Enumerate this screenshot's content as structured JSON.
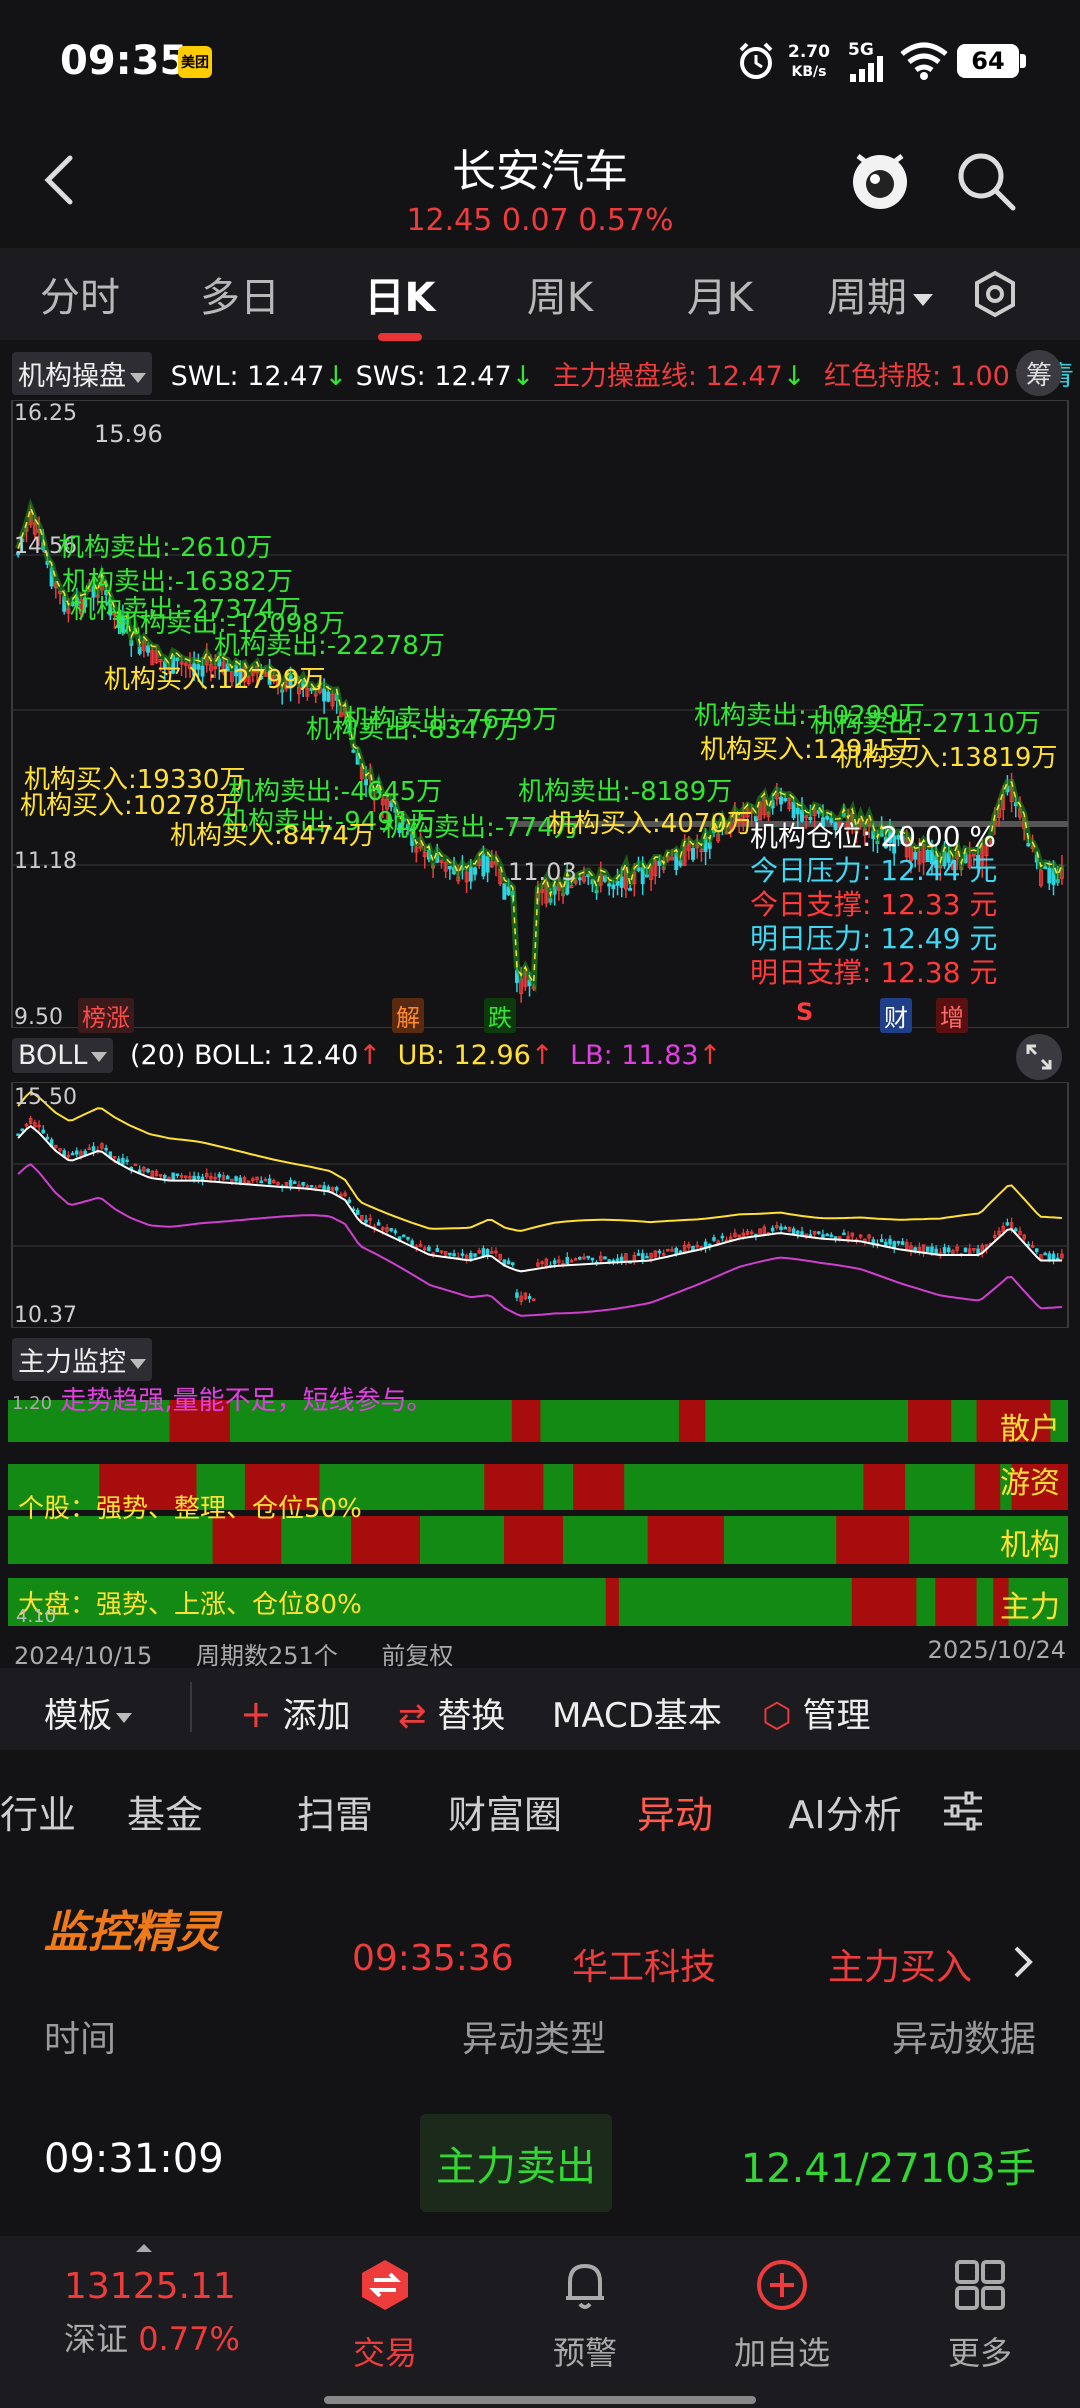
{
  "status": {
    "time": "09:35",
    "app_badge": "美团",
    "net_speed_value": "2.70",
    "net_speed_unit": "KB/s",
    "network": "5G",
    "battery": "64"
  },
  "header": {
    "stock_name": "长安汽车",
    "quote": "12.45 0.07 0.57%"
  },
  "period_tabs": [
    "分时",
    "多日",
    "日K",
    "周K",
    "月K",
    "周期"
  ],
  "main_indicator": {
    "selector": "机构操盘",
    "swl": "SWL: 12.47",
    "sws": "SWS: 12.47",
    "main_line": "主力操盘线: 12.47",
    "red_hold": "红色持股: 1.00",
    "cyan": "青",
    "chip_label": "筹",
    "y_labels": [
      "16.25",
      "14.56",
      "11.18",
      "9.50"
    ],
    "high_label": "15.96",
    "low_label": "11.03",
    "stats": [
      {
        "label": "机构仓位:",
        "value": "20.00 %",
        "color": "#ffffff"
      },
      {
        "label": "今日压力:",
        "value": "12.44 元",
        "color": "#3fd7f2"
      },
      {
        "label": "今日支撑:",
        "value": "12.33 元",
        "color": "#ff3a3a"
      },
      {
        "label": "明日压力:",
        "value": "12.49 元",
        "color": "#3fd7f2"
      },
      {
        "label": "明日支撑:",
        "value": "12.38 元",
        "color": "#ff3a3a"
      }
    ],
    "event_tags": [
      "榜涨",
      "解",
      "跌",
      "S",
      "财",
      "增"
    ],
    "annotations": [
      {
        "text": "机构卖出:-2610万",
        "color": "#33e633"
      },
      {
        "text": "机构卖出:-16382万",
        "color": "#33e633"
      },
      {
        "text": "机构卖出:-27374万",
        "color": "#33e633"
      },
      {
        "text": "机构卖出:-12098万",
        "color": "#33e633"
      },
      {
        "text": "机构卖出:-22278万",
        "color": "#33e633"
      },
      {
        "text": "机构买入:12799万",
        "color": "#ffe033"
      },
      {
        "text": "机构卖出:-7679万",
        "color": "#33e633"
      },
      {
        "text": "机构卖出:-8347万",
        "color": "#33e633"
      },
      {
        "text": "机构买入:19330万",
        "color": "#ffe033"
      },
      {
        "text": "机构买入:10278万",
        "color": "#ffe033"
      },
      {
        "text": "机构卖出:-4645万",
        "color": "#33e633"
      },
      {
        "text": "机构卖出:-9491万",
        "color": "#33e633"
      },
      {
        "text": "机构买入:8474万",
        "color": "#ffe033"
      },
      {
        "text": "机构卖出:-774万",
        "color": "#33e633"
      },
      {
        "text": "机构卖出:-8189万",
        "color": "#33e633"
      },
      {
        "text": "机构买入:4070万",
        "color": "#ffe033"
      },
      {
        "text": "机构卖出:-10299万",
        "color": "#33e633"
      },
      {
        "text": "机构卖出:-27110万",
        "color": "#33e633"
      },
      {
        "text": "机构买入:12915万",
        "color": "#ffe033"
      },
      {
        "text": "机构买入:13819万",
        "color": "#ffe033"
      }
    ]
  },
  "boll": {
    "selector": "BOLL",
    "params": "(20) BOLL: 12.40",
    "ub": "UB: 12.96",
    "lb": "LB: 11.83",
    "y_labels": [
      "15.50",
      "10.37"
    ]
  },
  "monitor": {
    "selector": "主力监控",
    "top_text": "走势趋强,量能不足，短线参与。",
    "bottom_label": "4.10",
    "top_label": "1.20",
    "rows": [
      {
        "label": "散户",
        "text": ""
      },
      {
        "label": "游资",
        "text": "个股：强势、整理、仓位50%"
      },
      {
        "label": "机构",
        "text": ""
      },
      {
        "label": "主力",
        "text": "大盘：强势、上涨、仓位80%"
      }
    ],
    "date_start": "2024/10/15",
    "periods": "周期数251个",
    "adjust": "前复权",
    "date_end": "2025/10/24"
  },
  "template_bar": {
    "template": "模板",
    "add": "添加",
    "replace": "替换",
    "macd": "MACD基本",
    "manage": "管理"
  },
  "info_tabs": [
    "行业",
    "基金",
    "扫雷",
    "财富圈",
    "异动",
    "AI分析"
  ],
  "ticker": {
    "logo": "监控精灵",
    "time": "09:35:36",
    "stock": "华工科技",
    "type": "主力买入"
  },
  "log": {
    "headers": [
      "时间",
      "异动类型",
      "异动数据"
    ],
    "row": {
      "time": "09:31:09",
      "type": "主力卖出",
      "data": "12.41/27103手"
    }
  },
  "bottom_nav": {
    "index_value": "13125.11",
    "index_name": "深证",
    "index_change": "0.77%",
    "items": [
      "交易",
      "预警",
      "加自选",
      "更多"
    ]
  },
  "colors": {
    "up": "#ee3b3b",
    "down": "#2fd3e0",
    "green": "#1f9e1f",
    "red": "#b50f0f",
    "yellow": "#ffe033"
  }
}
